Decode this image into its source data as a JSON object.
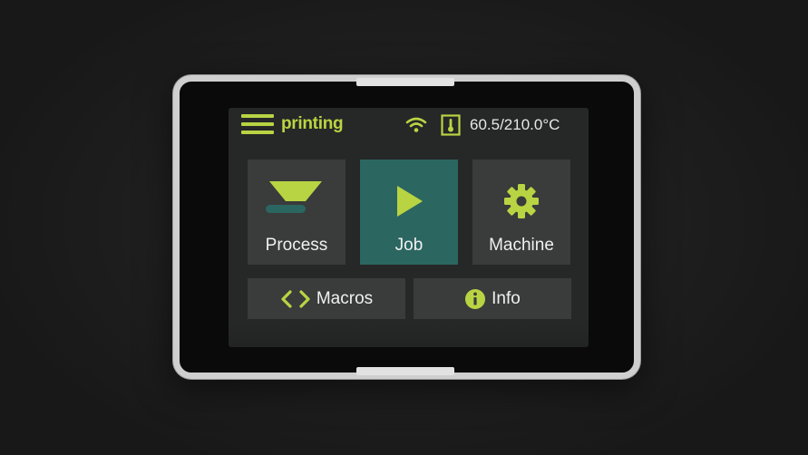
{
  "status_bar": {
    "status": "printing",
    "temperature": "60.5/210.0°C",
    "icons": {
      "menu": "hamburger-menu-icon",
      "wifi": "wifi-icon",
      "thermo": "thermometer-icon"
    }
  },
  "tiles": {
    "process": {
      "label": "Process",
      "icon": "extruder-hopper-icon"
    },
    "job": {
      "label": "Job",
      "icon": "play-icon"
    },
    "machine": {
      "label": "Machine",
      "icon": "gear-icon"
    },
    "macros": {
      "label": "Macros",
      "icon": "code-brackets-icon"
    },
    "info": {
      "label": "Info",
      "icon": "info-icon"
    }
  },
  "colors": {
    "accent": "#b9d443",
    "tile_bg": "#3a3b3b",
    "tile_active": "#2b6661",
    "screen_bg": "#262727",
    "text": "#f0f0f0"
  }
}
